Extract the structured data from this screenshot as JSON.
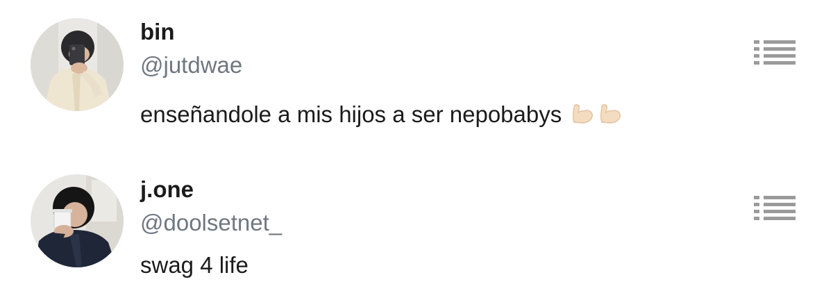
{
  "posts": [
    {
      "display_name": "bin",
      "handle": "@jutdwae",
      "text": "enseñandole a mis hijos a ser nepobabys",
      "emojis": [
        "flexed-biceps",
        "flexed-biceps"
      ],
      "avatar_icon": "profile-photo-mirror-selfie",
      "menu_icon": "list-menu-icon"
    },
    {
      "display_name": "j.one",
      "handle": "@doolsetnet_",
      "text": "swag 4 life",
      "emojis": [],
      "avatar_icon": "profile-photo-drinking-cup",
      "menu_icon": "list-menu-icon"
    }
  ],
  "colors": {
    "name": "#1b1b1b",
    "handle": "#6f7780",
    "menu_icon": "#9a9a9a",
    "background": "#ffffff"
  }
}
